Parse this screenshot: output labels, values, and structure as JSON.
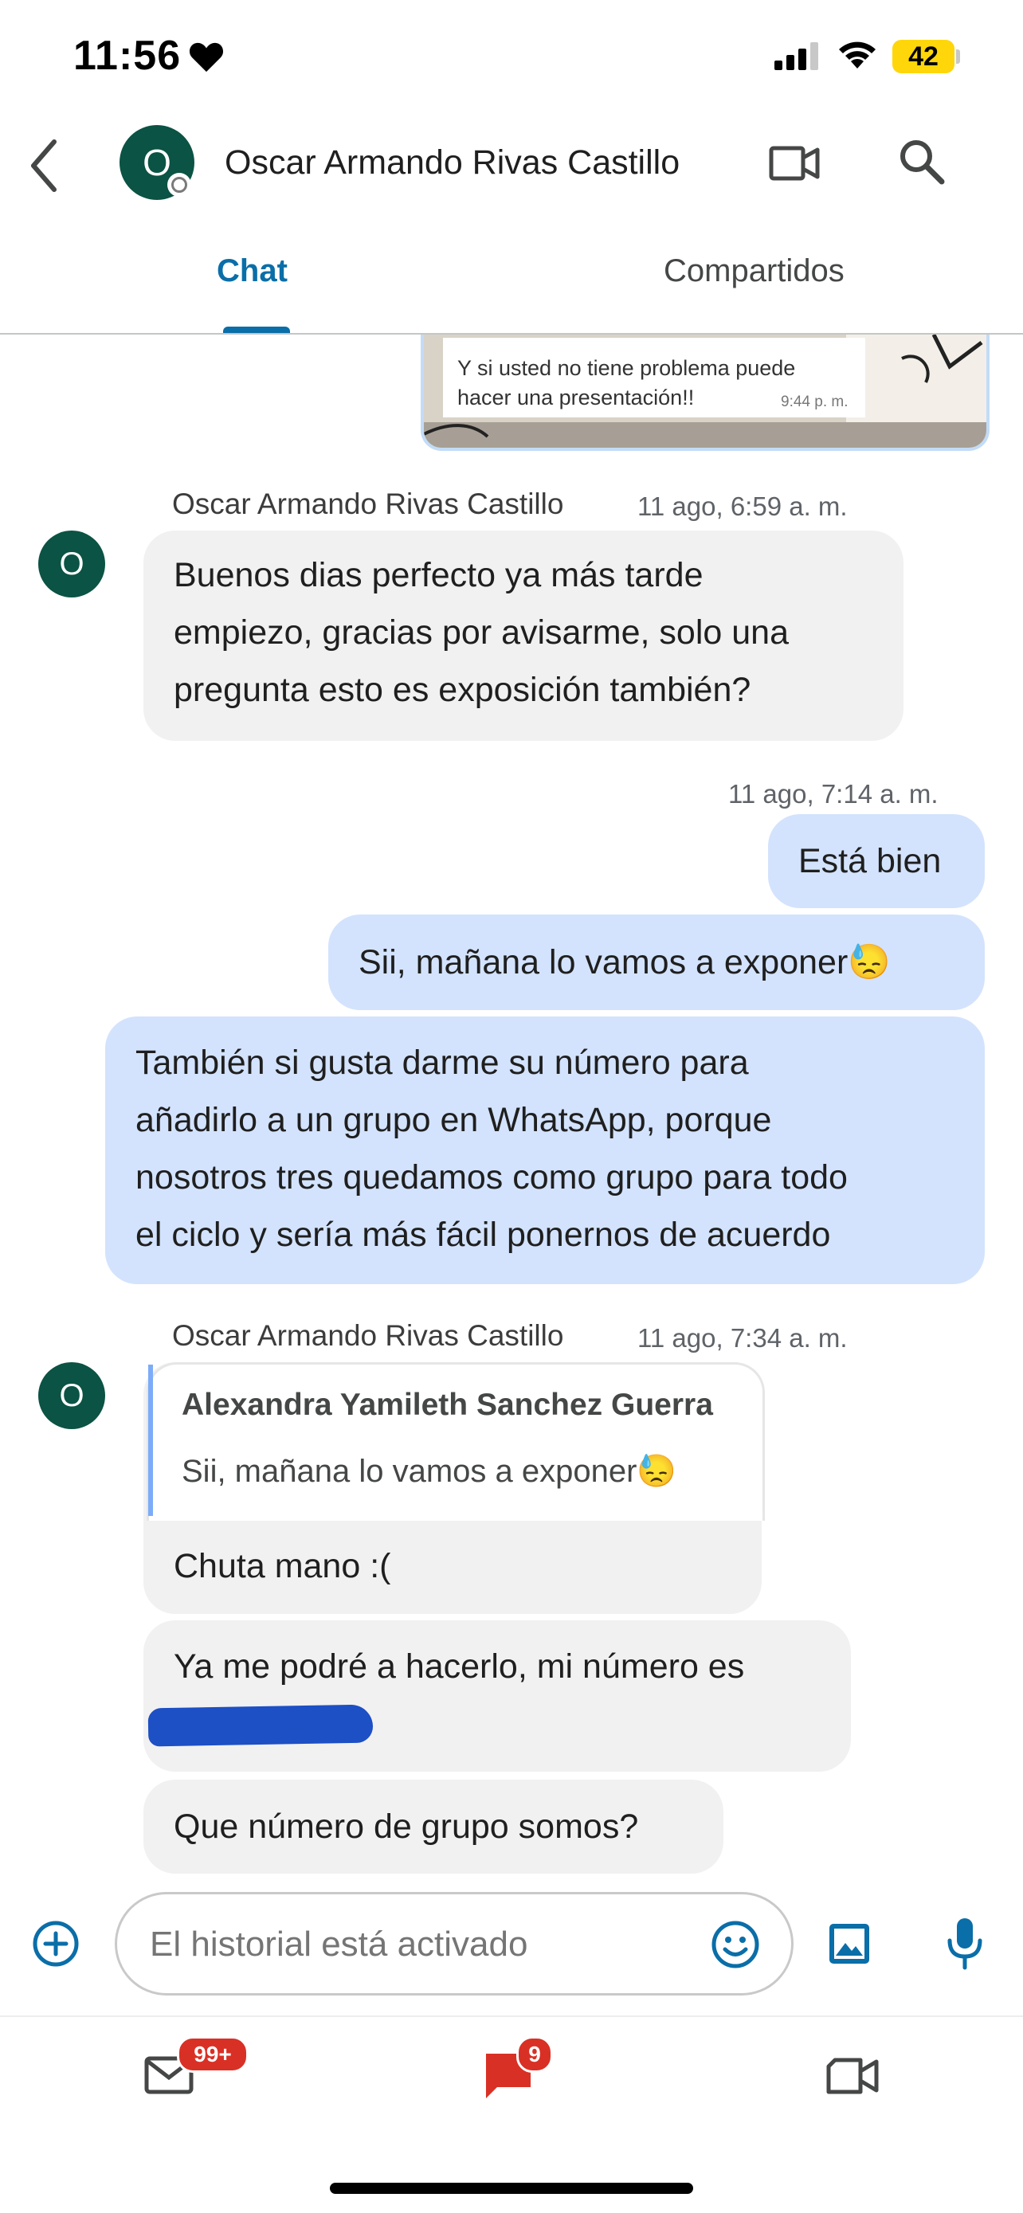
{
  "status_bar": {
    "time": "11:56",
    "battery": "42"
  },
  "header": {
    "contact_name": "Oscar Armando Rivas Castillo",
    "avatar_initial": "O"
  },
  "tabs": [
    {
      "label": "Chat"
    },
    {
      "label": "Compartidos"
    }
  ],
  "shared_image": {
    "caption_line1": "Y si usted no tiene problema puede",
    "caption_line2": "hacer una presentación!!",
    "caption_time": "9:44 p. m."
  },
  "messages": {
    "group1": {
      "sender": "Oscar Armando Rivas Castillo",
      "time": "11 ago, 6:59 a. m.",
      "avatar_initial": "O",
      "lines": [
        "Buenos dias perfecto ya más tarde",
        "empiezo, gracias por avisarme, solo una",
        "pregunta esto es exposición también?"
      ]
    },
    "group2": {
      "time": "11 ago, 7:14 a. m.",
      "msg1": "Está bien",
      "msg2": "Sii, mañana lo vamos a exponer😓",
      "msg3_lines": [
        "También si gusta darme su número para",
        "añadirlo a un grupo en WhatsApp, porque",
        "nosotros tres quedamos como grupo para todo",
        "el ciclo y sería más fácil ponernos de acuerdo"
      ]
    },
    "group3": {
      "sender": "Oscar Armando Rivas Castillo",
      "time": "11 ago, 7:34 a. m.",
      "avatar_initial": "O",
      "quote_author": "Alexandra Yamileth Sanchez Guerra",
      "quote_text": "Sii, mañana lo vamos a exponer😓",
      "msg1": "Chuta mano :(",
      "msg2": "Ya me podré a hacerlo, mi número es",
      "msg3": "Que número de grupo somos?"
    }
  },
  "composer": {
    "placeholder": "El historial está activado"
  },
  "bottom_nav": {
    "mail_badge": "99+",
    "chat_badge": "9"
  },
  "colors": {
    "accent": "#0a6ea8",
    "avatar": "#0b5344",
    "outgoing": "#d3e3fd",
    "incoming": "#f1f1f1",
    "badge": "#d93025",
    "chat_icon": "#d93025"
  },
  "icons": [
    "heart-icon",
    "signal-icon",
    "wifi-icon",
    "back-arrow-icon",
    "video-call-icon",
    "search-icon",
    "add-icon",
    "emoji-icon",
    "image-icon",
    "mic-icon",
    "mail-icon",
    "chat-icon",
    "meet-icon"
  ]
}
